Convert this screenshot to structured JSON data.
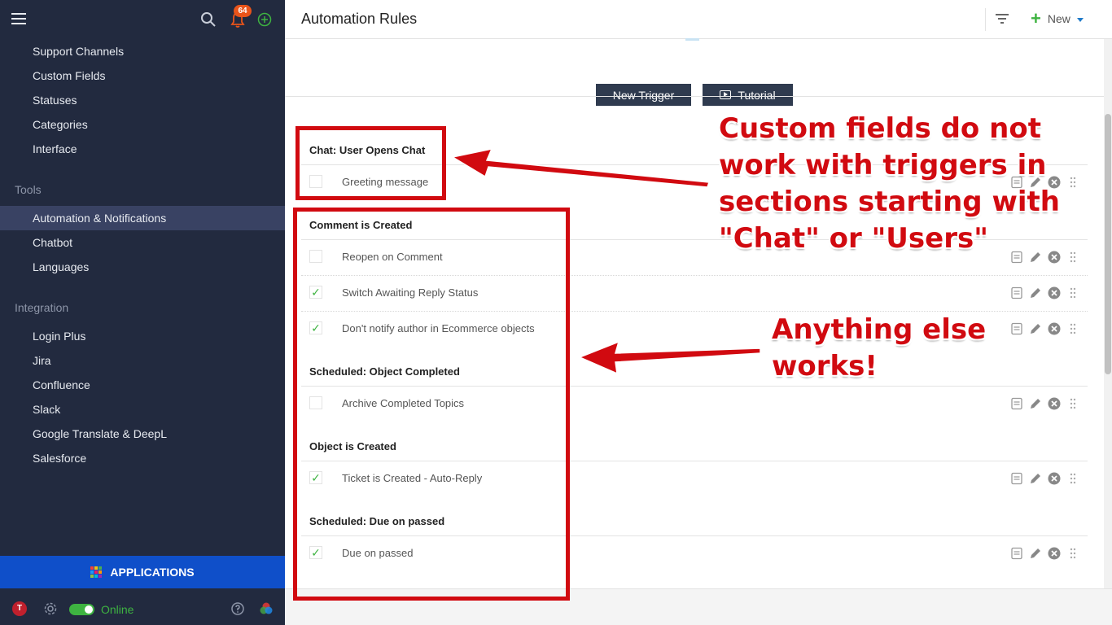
{
  "sidebar": {
    "notifications_count": "64",
    "items_top": [
      "Support Channels",
      "Custom Fields",
      "Statuses",
      "Categories",
      "Interface"
    ],
    "tools_heading": "Tools",
    "tools_items": [
      "Automation & Notifications",
      "Chatbot",
      "Languages"
    ],
    "integration_heading": "Integration",
    "integration_items": [
      "Login Plus",
      "Jira",
      "Confluence",
      "Slack",
      "Google Translate & DeepL",
      "Salesforce"
    ],
    "active_item": "Automation & Notifications",
    "applications_label": "APPLICATIONS",
    "avatar_initial": "T",
    "status_label": "Online"
  },
  "header": {
    "title": "Automation Rules",
    "new_label": "New"
  },
  "toolbar": {
    "new_trigger_label": "New Trigger",
    "tutorial_label": "Tutorial"
  },
  "groups": [
    {
      "title": "Chat: User Opens Chat",
      "rules": [
        {
          "label": "Greeting message",
          "enabled": false
        }
      ]
    },
    {
      "title": "Comment is Created",
      "rules": [
        {
          "label": "Reopen on Comment",
          "enabled": false
        },
        {
          "label": "Switch Awaiting Reply Status",
          "enabled": true
        },
        {
          "label": "Don't notify author in Ecommerce objects",
          "enabled": true
        }
      ]
    },
    {
      "title": "Scheduled: Object Completed",
      "rules": [
        {
          "label": "Archive Completed Topics",
          "enabled": false
        }
      ]
    },
    {
      "title": "Object is Created",
      "rules": [
        {
          "label": "Ticket is Created - Auto-Reply",
          "enabled": true
        }
      ]
    },
    {
      "title": "Scheduled: Due on passed",
      "rules": [
        {
          "label": "Due on passed",
          "enabled": true
        }
      ]
    }
  ],
  "annotations": {
    "note_1": "Custom fields do not\nwork with triggers in\nsections starting with\n\"Chat\" or \"Users\"",
    "note_2": "Anything else\nworks!",
    "color": "#d10a10"
  },
  "colors": {
    "sidebar_bg": "#222a3f",
    "active_item_bg": "#394263",
    "applications_bg": "#0f4fc9",
    "online_green": "#3eb341",
    "button_dark": "#2f3b4f"
  },
  "checkmark": "✓"
}
